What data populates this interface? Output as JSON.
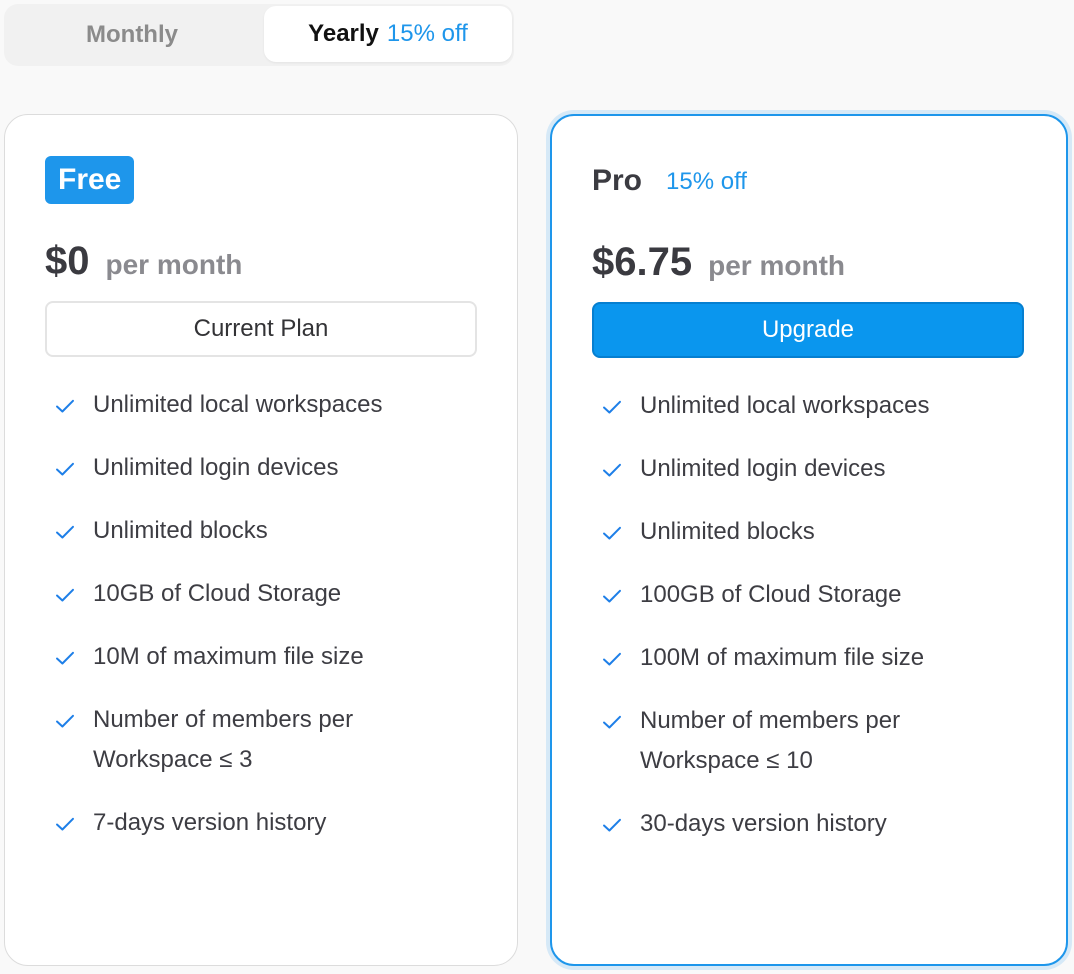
{
  "billing_toggle": {
    "monthly": "Monthly",
    "yearly": "Yearly",
    "yearly_discount": "15% off",
    "selected": "Yearly"
  },
  "plans": {
    "free": {
      "name": "Free",
      "price": "$0",
      "period": "per month",
      "button_label": "Current Plan",
      "features": [
        "Unlimited local workspaces",
        "Unlimited login devices",
        "Unlimited blocks",
        "10GB of Cloud Storage",
        "10M of maximum file size",
        "Number of members per\nWorkspace ≤ 3",
        "7-days version history"
      ]
    },
    "pro": {
      "name": "Pro",
      "discount": "15% off",
      "price": "$6.75",
      "period": "per month",
      "button_label": "Upgrade",
      "features": [
        "Unlimited local workspaces",
        "Unlimited login devices",
        "Unlimited blocks",
        "100GB of Cloud Storage",
        "100M of maximum file size",
        "Number of members per\nWorkspace ≤ 10",
        "30-days version history"
      ]
    }
  },
  "colors": {
    "accent": "#1E96EB",
    "background": "#F9F9F9",
    "card": "#FFFFFF",
    "muted_text": "#8A8A8F"
  },
  "icons": {
    "feature_check": "check-icon"
  }
}
